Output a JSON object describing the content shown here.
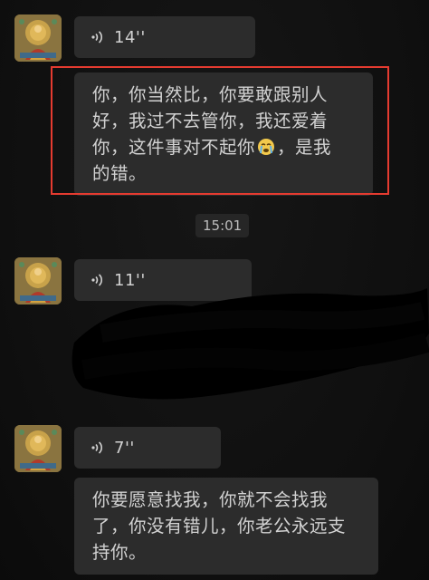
{
  "messages": [
    {
      "type": "voice",
      "duration": "14''"
    },
    {
      "type": "text",
      "lines": [
        "你，你当然比，你要敢跟别人",
        "好，我过不去管你，我还爱着",
        "你，这件事对不起你",
        "，是我",
        "的错。"
      ]
    },
    {
      "type": "timestamp",
      "text": "15:01"
    },
    {
      "type": "voice",
      "duration": "11''"
    },
    {
      "type": "voice",
      "duration": "7''"
    },
    {
      "type": "text",
      "lines": [
        "你要愿意找我，你就不会找我",
        "了，你没有错儿，你老公永远支",
        "持你。"
      ]
    }
  ],
  "icons": {
    "voice": "voice-wave-icon",
    "emoji": "crying-emoji-icon",
    "avatar": "buddha-thangka-avatar"
  },
  "colors": {
    "background": "#111111",
    "bubble": "#2c2c2c",
    "highlight": "#e53b30",
    "text": "#d2d2d2"
  }
}
